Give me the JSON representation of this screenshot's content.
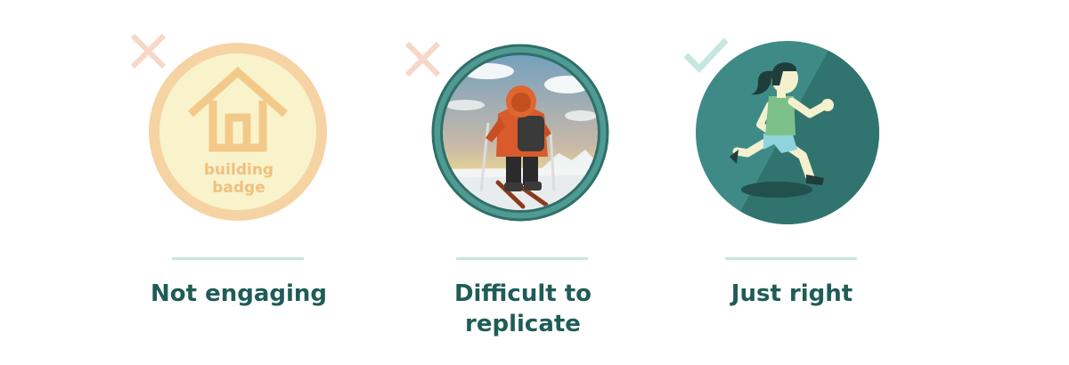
{
  "cards": [
    {
      "status": "rejected",
      "status_icon": "cross-icon",
      "badge_lines": [
        "building",
        "badge"
      ],
      "caption": "Not engaging"
    },
    {
      "status": "rejected",
      "status_icon": "cross-icon",
      "caption_lines": [
        "Difficult to",
        "replicate"
      ]
    },
    {
      "status": "approved",
      "status_icon": "checkmark-icon",
      "caption": "Just right"
    }
  ],
  "colors": {
    "caption": "#1f5c57",
    "divider": "#c6e6df",
    "cross": "#f6d3c3",
    "check": "#c6e6df",
    "badge_ring": "#f6d3a3",
    "badge_fill": "#f8f2c9",
    "teal": "#3f8a86",
    "teal_dark": "#2e6f6b"
  }
}
